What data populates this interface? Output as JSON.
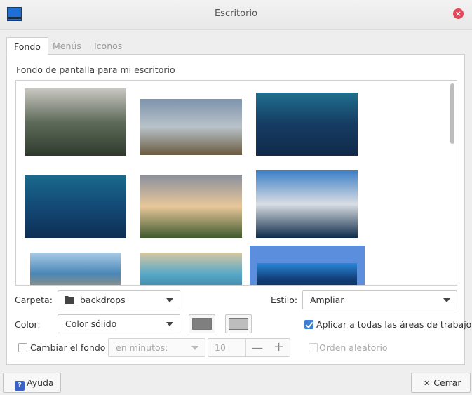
{
  "window": {
    "title": "Escritorio",
    "close_glyph": "×"
  },
  "tabs": [
    {
      "label": "Fondo",
      "active": true
    },
    {
      "label": "Menús",
      "active": false
    },
    {
      "label": "Iconos",
      "active": false
    }
  ],
  "fondo": {
    "section_label": "Fondo de pantalla para mi escritorio",
    "wallpapers": [
      {
        "name": "mountain-cliffs",
        "colors": [
          "#c9c7c2",
          "#5f6b5a",
          "#2f3a2c"
        ]
      },
      {
        "name": "farm-field-clouds",
        "colors": [
          "#7d93ad",
          "#b9c2c9",
          "#6a5a3f"
        ]
      },
      {
        "name": "blue-aurora-1",
        "colors": [
          "#1f6f8e",
          "#163c63",
          "#0f2a4a"
        ]
      },
      {
        "name": "blue-aurora-2",
        "colors": [
          "#1a6a8c",
          "#134a75",
          "#0e2e55"
        ]
      },
      {
        "name": "cliff-sunset",
        "colors": [
          "#8a8f9c",
          "#e8c79a",
          "#3f5a2e"
        ]
      },
      {
        "name": "snowy-mountains",
        "colors": [
          "#3c7fc7",
          "#d9dde3",
          "#0f2c4a"
        ]
      },
      {
        "name": "rocky-coast",
        "colors": [
          "#a9cbe6",
          "#4a87b8",
          "#b89466"
        ]
      },
      {
        "name": "turquoise-beach",
        "colors": [
          "#d7c7a1",
          "#5aa9c6",
          "#2f7aa0"
        ]
      },
      {
        "name": "blue-tree",
        "colors": [
          "#2a86d9",
          "#123f7a",
          "#08233f"
        ]
      }
    ],
    "selected_index": 8
  },
  "folder": {
    "label": "Carpeta:",
    "value": "backdrops"
  },
  "style": {
    "label": "Estilo:",
    "value": "Ampliar"
  },
  "color": {
    "label": "Color:",
    "value": "Color sólido",
    "swatch1": "#7f7f7f",
    "swatch2": "#bdbdbd"
  },
  "apply_all": {
    "label": "Aplicar a todas las áreas de trabajo",
    "checked": true
  },
  "change_bg": {
    "label": "Cambiar el fondo",
    "checked": false,
    "interval": "en minutos:",
    "minutes": "10",
    "minus": "—",
    "plus": "+"
  },
  "random": {
    "label": "Orden aleatorio",
    "checked": false
  },
  "footer": {
    "help_label": "Ayuda",
    "help_glyph": "?",
    "close_label": "Cerrar",
    "close_glyph": "✕"
  }
}
